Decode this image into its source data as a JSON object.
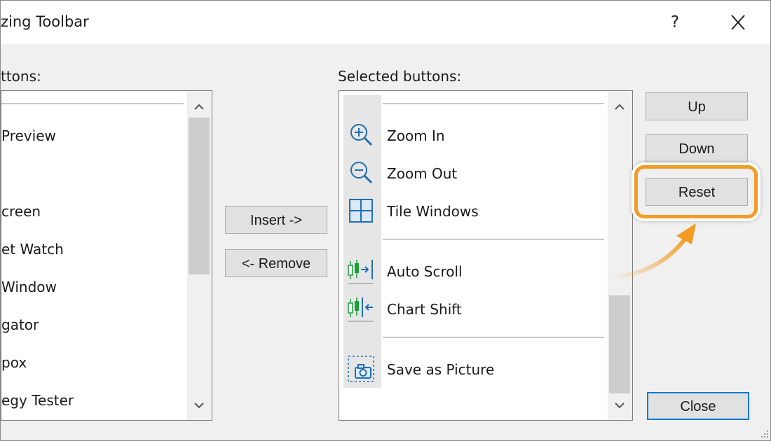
{
  "window": {
    "title": "zing Toolbar",
    "help_glyph": "?",
    "close_icon": "close-icon"
  },
  "available": {
    "label": "ttons:",
    "items": [
      "Preview",
      "creen",
      "et Watch",
      "Window",
      "gator",
      "pox",
      "egy Tester"
    ]
  },
  "selected": {
    "label": "Selected buttons:",
    "items": [
      "Zoom In",
      "Zoom Out",
      "Tile Windows",
      "Auto Scroll",
      "Chart Shift",
      "Save as Picture"
    ],
    "icons": [
      "zoom-in-icon",
      "zoom-out-icon",
      "tile-windows-icon",
      "auto-scroll-icon",
      "chart-shift-icon",
      "save-as-picture-icon"
    ]
  },
  "buttons": {
    "insert": "Insert ->",
    "remove": "<- Remove",
    "up": "Up",
    "down": "Down",
    "reset": "Reset",
    "close": "Close"
  },
  "colors": {
    "highlight": "#f39b25",
    "accent_blue": "#1f6fb2",
    "chart_green": "#1e9e3a",
    "default_button_border": "#0078d7"
  }
}
